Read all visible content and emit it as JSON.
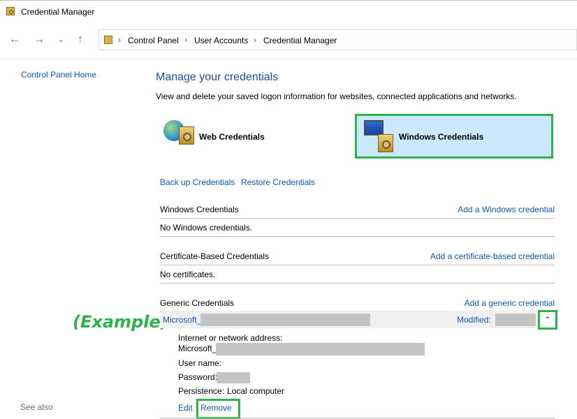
{
  "window": {
    "title": "Credential Manager"
  },
  "nav": {
    "back_icon": "arrow-left-icon",
    "forward_icon": "arrow-right-icon",
    "recent_icon": "chevron-down-icon",
    "up_icon": "arrow-up-icon",
    "breadcrumbs": [
      "Control Panel",
      "User Accounts",
      "Credential Manager"
    ]
  },
  "sidebar": {
    "home_link": "Control Panel Home",
    "see_also": "See also"
  },
  "main": {
    "title": "Manage your credentials",
    "subtitle": "View and delete your saved logon information for websites, connected applications and networks.",
    "tiles": {
      "web": "Web Credentials",
      "windows": "Windows Credentials"
    },
    "actions": {
      "backup": "Back up Credentials",
      "restore": "Restore Credentials"
    },
    "sections": {
      "windows": {
        "title": "Windows Credentials",
        "add": "Add a Windows credential",
        "empty": "No Windows credentials."
      },
      "certificate": {
        "title": "Certificate-Based Credentials",
        "add": "Add a certificate-based credential",
        "empty": "No certificates."
      },
      "generic": {
        "title": "Generic Credentials",
        "add": "Add a generic credential",
        "example_label": "(Example)",
        "item": {
          "name": "Microsoft_",
          "modified_label": "Modified:",
          "details": {
            "address_label": "Internet or network address:",
            "address_value": "Microsoft_",
            "username_label": "User name:",
            "password_label": "Password:",
            "persistence_label": "Persistence:",
            "persistence_value": "Local computer"
          },
          "edit": "Edit",
          "remove": "Remove"
        }
      }
    }
  },
  "colors": {
    "link": "#0e57b8",
    "highlight": "#2db34a",
    "selected_tile": "#cce8ff",
    "redacted": "#c4c4c4"
  }
}
